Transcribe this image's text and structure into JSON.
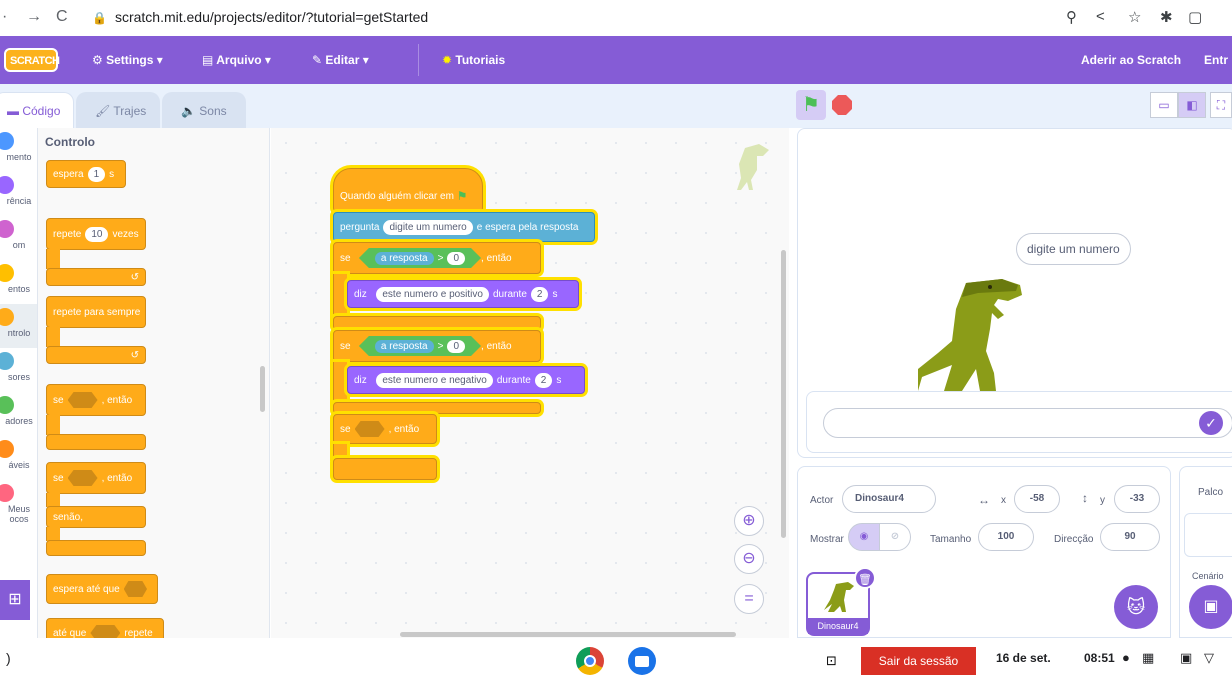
{
  "browser": {
    "url": "scratch.mit.edu/projects/editor/?tutorial=getStarted"
  },
  "menu": {
    "logo": "SCRATCH",
    "settings": "Settings",
    "file": "Arquivo",
    "edit": "Editar",
    "tutorials": "Tutoriais",
    "join": "Aderir ao Scratch",
    "signin": "Entr"
  },
  "tabs": {
    "code": "Código",
    "costumes": "Trajes",
    "sounds": "Sons"
  },
  "categories": [
    {
      "label": "mento",
      "color": "#4c97ff"
    },
    {
      "label": "rência",
      "color": "#9966ff"
    },
    {
      "label": "om",
      "color": "#cf63cf"
    },
    {
      "label": "entos",
      "color": "#ffbf00"
    },
    {
      "label": "ntrolo",
      "color": "#ffab19"
    },
    {
      "label": "sores",
      "color": "#5cb1d6"
    },
    {
      "label": "adores",
      "color": "#59c059"
    },
    {
      "label": "áveis",
      "color": "#ff8c1a"
    },
    {
      "label": "Meus",
      "label2": "ocos",
      "color": "#ff6680"
    }
  ],
  "palette": {
    "title": "Controlo",
    "wait": "espera",
    "wait_val": "1",
    "wait_unit": "s",
    "repeat": "repete",
    "repeat_val": "10",
    "repeat_unit": "vezes",
    "forever": "repete para sempre",
    "if": "se",
    "then": ", então",
    "else": "senão,",
    "wait_until": "espera até que",
    "until": "até que",
    "until_repeat": "repete"
  },
  "script": {
    "hat": "Quando alguém clicar em",
    "ask": "pergunta",
    "ask_val": "digite um numero",
    "ask_tail": "e espera pela resposta",
    "if": "se",
    "answer": "a resposta",
    "gt": ">",
    "zero": "0",
    "then": ", então",
    "say": "diz",
    "say1": "este numero e positivo",
    "during": "durante",
    "secs": "2",
    "s": "s",
    "say2": "este numero e negativo"
  },
  "stage": {
    "speech": "digite um numero"
  },
  "sprite": {
    "actor_label": "Actor",
    "actor": "Dinosaur4",
    "x_label": "x",
    "x": "-58",
    "y_label": "y",
    "y": "-33",
    "show_label": "Mostrar",
    "size_label": "Tamanho",
    "size": "100",
    "direction_label": "Direcção",
    "direction": "90",
    "tile_name": "Dinosaur4"
  },
  "stage_pane": {
    "title": "Palco",
    "backdrops": "Cenário"
  },
  "taskbar": {
    "logout": "Sair da sessão",
    "date": "16 de set.",
    "time": "08:51"
  },
  "colors": {
    "scratch_purple": "#855cd6",
    "control": "#ffab19",
    "sensing": "#5cb1d6",
    "looks": "#9966ff",
    "operators": "#59c059"
  }
}
